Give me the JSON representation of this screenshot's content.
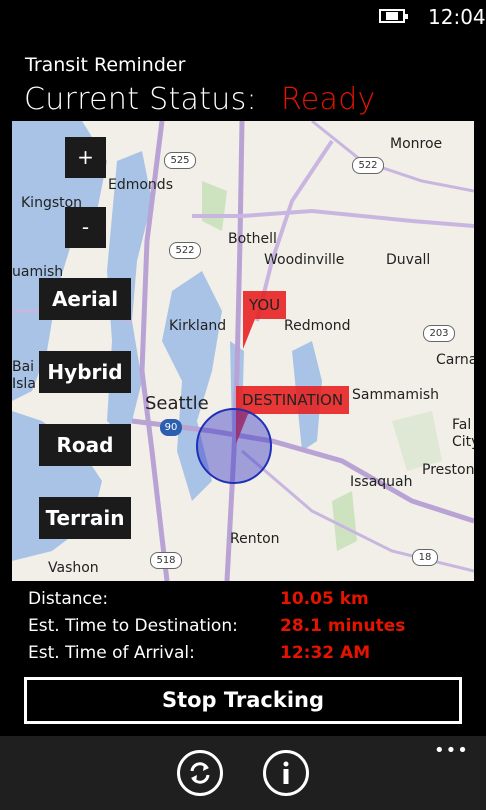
{
  "status_bar": {
    "time": "12:04",
    "battery_icon": "battery-charging-icon"
  },
  "app": {
    "title": "Transit Reminder"
  },
  "current_status": {
    "label": "Current Status:",
    "value": "Ready",
    "value_color": "#e51400"
  },
  "map": {
    "zoom_in": "+",
    "zoom_out": "-",
    "modes": [
      "Aerial",
      "Hybrid",
      "Road",
      "Terrain"
    ],
    "labels": {
      "monroe": "Monroe",
      "edmonds": "Edmonds",
      "kingston": "Kingston",
      "bothell": "Bothell",
      "woodinville": "Woodinville",
      "duvall": "Duvall",
      "kirkland": "Kirkland",
      "redmond": "Redmond",
      "carna": "Carna",
      "seattle": "Seattle",
      "sammamish": "Sammamish",
      "fall_city": "Fal\nCity",
      "issaquah": "Issaquah",
      "preston": "Preston",
      "renton": "Renton",
      "vashon": "Vashon",
      "suquamish": "uamish",
      "bainbridge": "Bai\nIsla"
    },
    "shields": [
      "525",
      "522",
      "522",
      "203",
      "90",
      "518",
      "18"
    ],
    "pins": {
      "you": "YOU",
      "destination": "DESTINATION"
    }
  },
  "stats": {
    "distance": {
      "label": "Distance:",
      "value": "10.05 km"
    },
    "eta_duration": {
      "label": "Est. Time to Destination:",
      "value": "28.1 minutes"
    },
    "eta_arrival": {
      "label": "Est. Time of Arrival:",
      "value": "12:32 AM"
    }
  },
  "stop_button": "Stop Tracking",
  "app_bar": {
    "refresh_icon": "refresh-icon",
    "info_icon": "info-icon",
    "more": "•••"
  }
}
